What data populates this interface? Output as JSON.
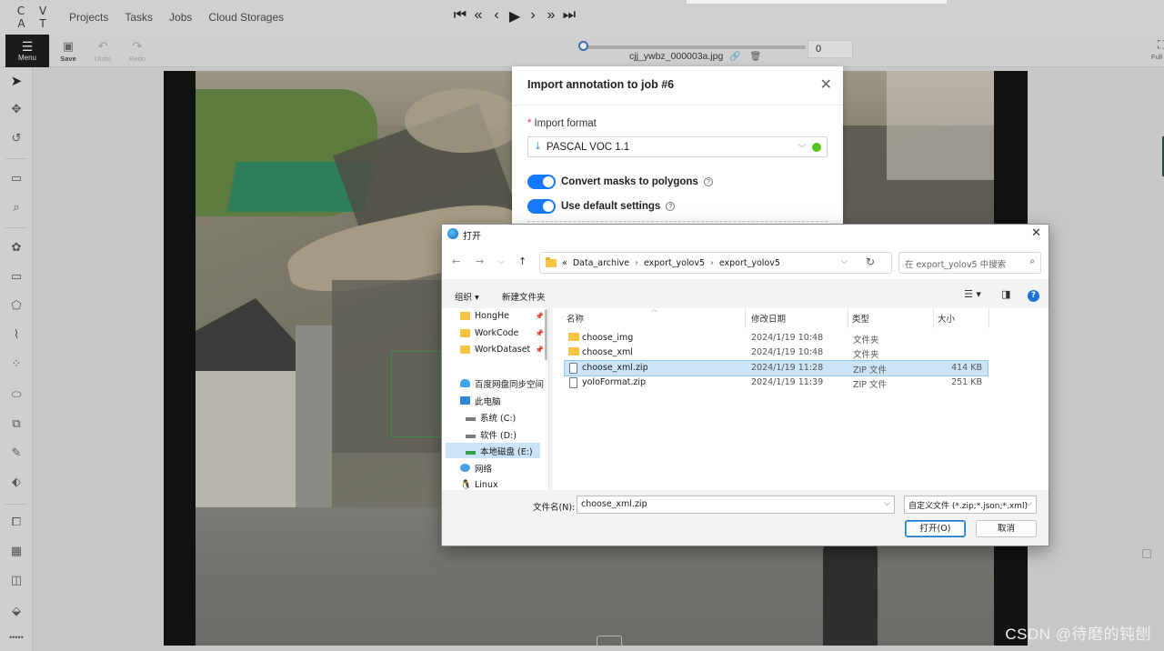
{
  "topbar": {
    "logo": "C V A T",
    "nav": [
      "Projects",
      "Tasks",
      "Jobs",
      "Cloud Storages"
    ]
  },
  "toolbar": {
    "menu_label": "Menu",
    "save_label": "Save",
    "undo_label": "Undo",
    "redo_label": "Redo",
    "frame_name": "cjj_ywbz_000003a.jpg",
    "frame_number": "0",
    "fullscreen_label": "Full",
    "player_icons": [
      "first-frame-icon",
      "back-step-icon",
      "prev-frame-icon",
      "play-icon",
      "next-frame-icon",
      "forward-step-icon",
      "last-frame-icon"
    ]
  },
  "modal": {
    "title": "Import annotation to job #6",
    "format_label": "Import format",
    "format_value": "PASCAL VOC 1.1",
    "convert_masks_label": "Convert masks to polygons",
    "default_settings_label": "Use default settings"
  },
  "dialog": {
    "title": "打开",
    "breadcrumb": [
      "Data_archive",
      "export_yolov5",
      "export_yolov5"
    ],
    "breadcrumb_prefix": "«",
    "search_placeholder": "在 export_yolov5 中搜索",
    "organize_label": "组织 ▾",
    "new_folder_label": "新建文件夹",
    "tree": [
      {
        "label": "HongHe",
        "icon": "folder",
        "pinned": true
      },
      {
        "label": "WorkCode",
        "icon": "folder",
        "pinned": true
      },
      {
        "label": "WorkDataset",
        "icon": "folder",
        "pinned": true
      },
      {
        "label": "百度网盘同步空间",
        "icon": "cloud",
        "pinned": false
      },
      {
        "label": "此电脑",
        "icon": "pc",
        "pinned": false
      },
      {
        "label": "系统 (C:)",
        "icon": "drive",
        "pinned": false
      },
      {
        "label": "软件 (D:)",
        "icon": "drive",
        "pinned": false
      },
      {
        "label": "本地磁盘 (E:)",
        "icon": "drive",
        "pinned": false,
        "selected": true
      },
      {
        "label": "网络",
        "icon": "net",
        "pinned": false
      },
      {
        "label": "Linux",
        "icon": "linux",
        "pinned": false
      }
    ],
    "columns": [
      "名称",
      "修改日期",
      "类型",
      "大小"
    ],
    "files": [
      {
        "name": "choose_img",
        "date": "2024/1/19 10:48",
        "type": "文件夹",
        "size": "",
        "kind": "folder"
      },
      {
        "name": "choose_xml",
        "date": "2024/1/19 10:48",
        "type": "文件夹",
        "size": "",
        "kind": "folder"
      },
      {
        "name": "choose_xml.zip",
        "date": "2024/1/19 11:28",
        "type": "ZIP 文件",
        "size": "414 KB",
        "kind": "zip",
        "selected": true
      },
      {
        "name": "yoloFormat.zip",
        "date": "2024/1/19 11:39",
        "type": "ZIP 文件",
        "size": "251 KB",
        "kind": "zip"
      }
    ],
    "filename_label": "文件名(N):",
    "filename_value": "choose_xml.zip",
    "filetype_value": "自定义文件 (*.zip;*.json;*.xml)",
    "open_label": "打开(O)",
    "cancel_label": "取消"
  },
  "watermark": "CSDN @待磨的钝刨"
}
